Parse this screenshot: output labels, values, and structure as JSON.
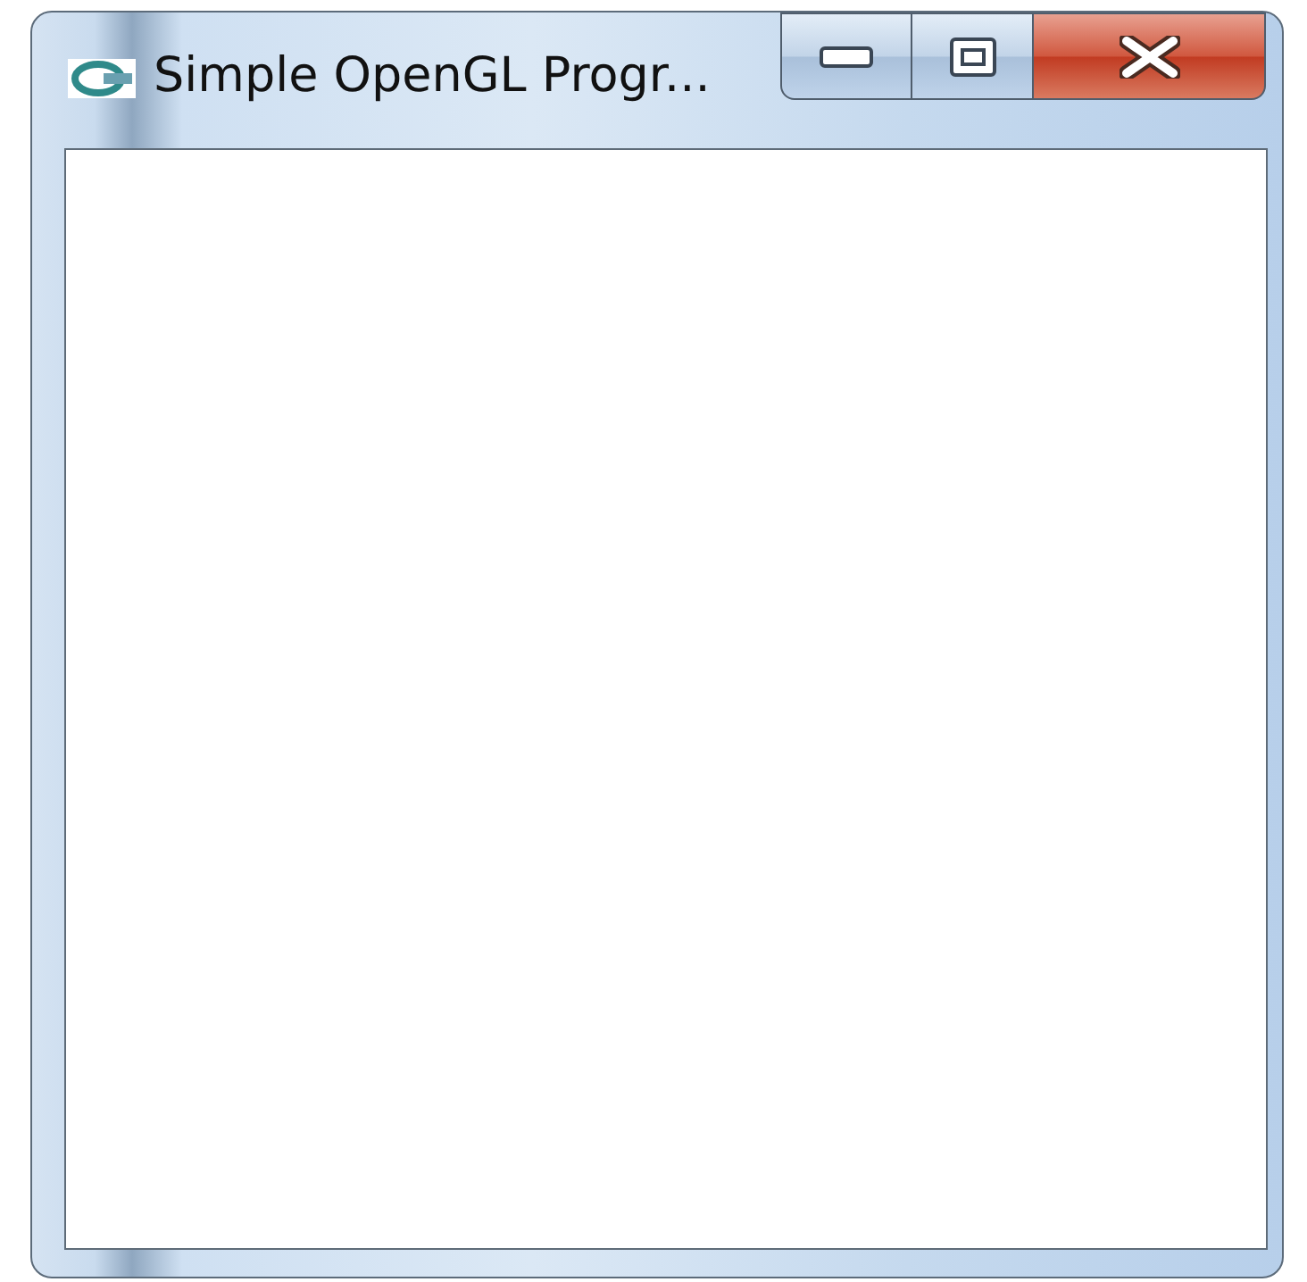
{
  "window": {
    "title": "Simple OpenGL Progr..."
  }
}
